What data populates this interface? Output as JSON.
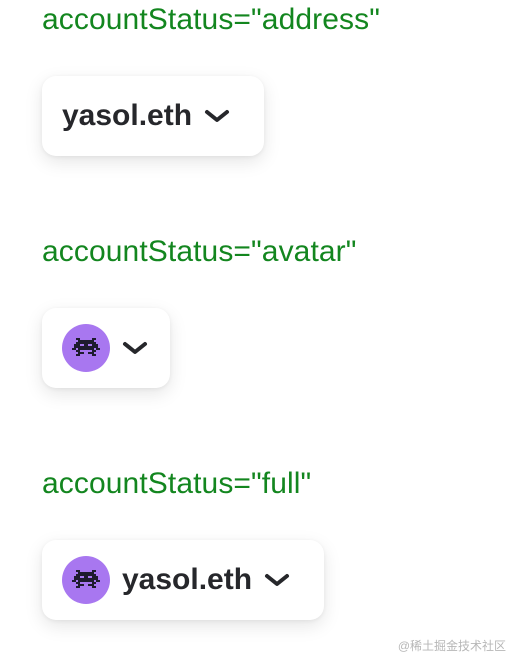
{
  "sections": [
    {
      "label": "accountStatus=\"address\"",
      "button": {
        "name": "yasol.eth",
        "dropdown_icon": "chevron-down-icon"
      }
    },
    {
      "label": "accountStatus=\"avatar\"",
      "button": {
        "avatar_icon": "avatar-pixel-icon",
        "dropdown_icon": "chevron-down-icon"
      }
    },
    {
      "label": "accountStatus=\"full\"",
      "button": {
        "name": "yasol.eth",
        "avatar_icon": "avatar-pixel-icon",
        "dropdown_icon": "chevron-down-icon"
      }
    }
  ],
  "watermark": "@稀土掘金技术社区",
  "colors": {
    "label": "#13861f",
    "text": "#26272b",
    "avatar_bg": "#a877f0",
    "button_bg": "#ffffff"
  }
}
